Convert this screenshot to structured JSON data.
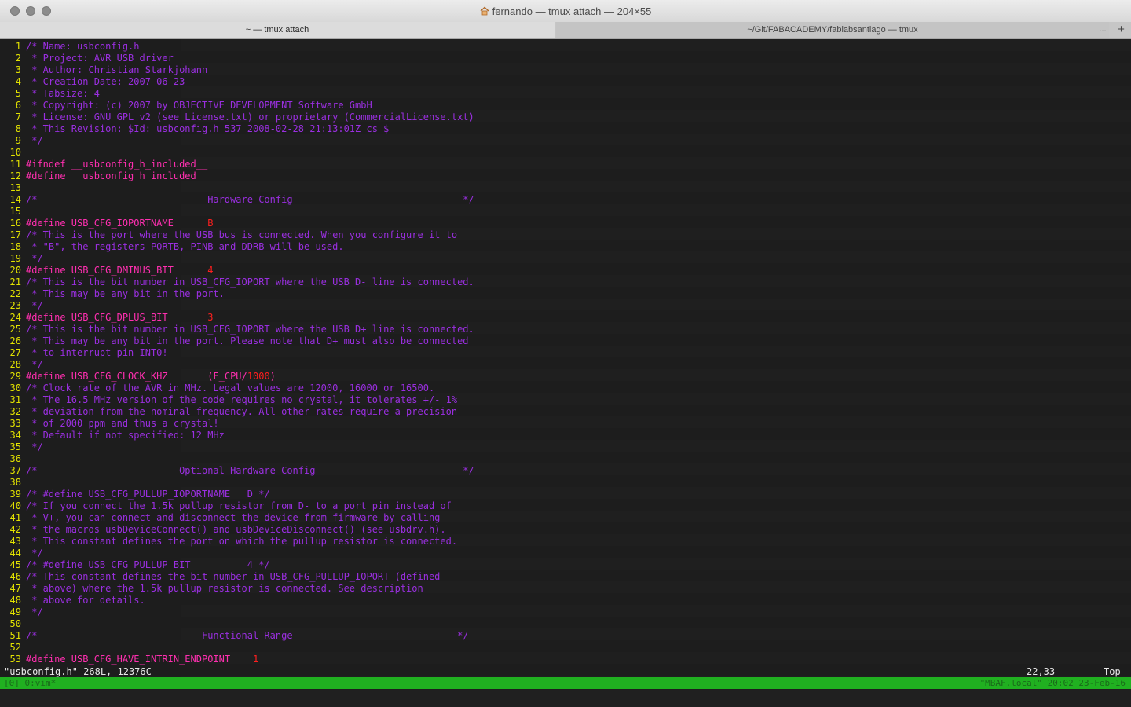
{
  "window": {
    "title": "fernando — tmux attach — 204×55",
    "tabs": [
      {
        "label": "~ — tmux attach"
      },
      {
        "label": "~/Git/FABACADEMY/fablabsantiago — tmux"
      }
    ],
    "more_label": "...",
    "add_label": "+"
  },
  "editor": {
    "lines": [
      {
        "n": "1",
        "text": "/* Name: usbconfig.h"
      },
      {
        "n": "2",
        "text": " * Project: AVR USB driver"
      },
      {
        "n": "3",
        "text": " * Author: Christian Starkjohann"
      },
      {
        "n": "4",
        "text": " * Creation Date: 2007-06-23"
      },
      {
        "n": "5",
        "text": " * Tabsize: 4"
      },
      {
        "n": "6",
        "text": " * Copyright: (c) 2007 by OBJECTIVE DEVELOPMENT Software GmbH"
      },
      {
        "n": "7",
        "text": " * License: GNU GPL v2 (see License.txt) or proprietary (CommercialLicense.txt)"
      },
      {
        "n": "8",
        "text": " * This Revision: $Id: usbconfig.h 537 2008-02-28 21:13:01Z cs $"
      },
      {
        "n": "9",
        "text": " */"
      },
      {
        "n": "10",
        "text": ""
      },
      {
        "n": "11",
        "text": "#ifndef __usbconfig_h_included__"
      },
      {
        "n": "12",
        "text": "#define __usbconfig_h_included__"
      },
      {
        "n": "13",
        "text": ""
      },
      {
        "n": "14",
        "text": "/* ---------------------------- Hardware Config ---------------------------- */"
      },
      {
        "n": "15",
        "text": ""
      },
      {
        "n": "16",
        "text": "#define USB_CFG_IOPORTNAME      ",
        "val": "B"
      },
      {
        "n": "17",
        "text": "/* This is the port where the USB bus is connected. When you configure it to"
      },
      {
        "n": "18",
        "text": " * \"B\", the registers PORTB, PINB and DDRB will be used."
      },
      {
        "n": "19",
        "text": " */"
      },
      {
        "n": "20",
        "text": "#define USB_CFG_DMINUS_BIT      ",
        "val": "4"
      },
      {
        "n": "21",
        "text": "/* This is the bit number in USB_CFG_IOPORT where the USB D- line is connected."
      },
      {
        "n": "22",
        "text": " * This may be any bit in the port."
      },
      {
        "n": "23",
        "text": " */"
      },
      {
        "n": "24",
        "text": "#define USB_CFG_DPLUS_BIT       ",
        "val": "3"
      },
      {
        "n": "25",
        "text": "/* This is the bit number in USB_CFG_IOPORT where the USB D+ line is connected."
      },
      {
        "n": "26",
        "text": " * This may be any bit in the port. Please note that D+ must also be connected"
      },
      {
        "n": "27",
        "text": " * to interrupt pin INT0!"
      },
      {
        "n": "28",
        "text": " */"
      },
      {
        "n": "29",
        "text": "#define USB_CFG_CLOCK_KHZ       (F_CPU/",
        "val": "1000",
        "tail": ")"
      },
      {
        "n": "30",
        "text": "/* Clock rate of the AVR in MHz. Legal values are 12000, 16000 or 16500."
      },
      {
        "n": "31",
        "text": " * The 16.5 MHz version of the code requires no crystal, it tolerates +/- 1%"
      },
      {
        "n": "32",
        "text": " * deviation from the nominal frequency. All other rates require a precision"
      },
      {
        "n": "33",
        "text": " * of 2000 ppm and thus a crystal!"
      },
      {
        "n": "34",
        "text": " * Default if not specified: 12 MHz"
      },
      {
        "n": "35",
        "text": " */"
      },
      {
        "n": "36",
        "text": ""
      },
      {
        "n": "37",
        "text": "/* ----------------------- Optional Hardware Config ------------------------ */"
      },
      {
        "n": "38",
        "text": ""
      },
      {
        "n": "39",
        "text": "/* #define USB_CFG_PULLUP_IOPORTNAME   D */"
      },
      {
        "n": "40",
        "text": "/* If you connect the 1.5k pullup resistor from D- to a port pin instead of"
      },
      {
        "n": "41",
        "text": " * V+, you can connect and disconnect the device from firmware by calling"
      },
      {
        "n": "42",
        "text": " * the macros usbDeviceConnect() and usbDeviceDisconnect() (see usbdrv.h)."
      },
      {
        "n": "43",
        "text": " * This constant defines the port on which the pullup resistor is connected."
      },
      {
        "n": "44",
        "text": " */"
      },
      {
        "n": "45",
        "text": "/* #define USB_CFG_PULLUP_BIT          4 */"
      },
      {
        "n": "46",
        "text": "/* This constant defines the bit number in USB_CFG_PULLUP_IOPORT (defined"
      },
      {
        "n": "47",
        "text": " * above) where the 1.5k pullup resistor is connected. See description"
      },
      {
        "n": "48",
        "text": " * above for details."
      },
      {
        "n": "49",
        "text": " */"
      },
      {
        "n": "50",
        "text": ""
      },
      {
        "n": "51",
        "text": "/* --------------------------- Functional Range --------------------------- */"
      },
      {
        "n": "52",
        "text": ""
      },
      {
        "n": "53",
        "text": "#define USB_CFG_HAVE_INTRIN_ENDPOINT    ",
        "val": "1"
      }
    ],
    "cmdline_file": "\"usbconfig.h\" 268L, 12376C",
    "cursor_pos": "22,33",
    "scroll_pos": "Top"
  },
  "tmux": {
    "status_left": "[0] 0:vim*",
    "status_right": "\"MBAF.local\" 20:02 23-Feb-16"
  },
  "colors": {
    "comment": "#9a2fe0",
    "preproc": "#ff2fb0",
    "number": "#ff1f1f",
    "line_number": "#e3e300",
    "status_bg": "#20b020"
  }
}
